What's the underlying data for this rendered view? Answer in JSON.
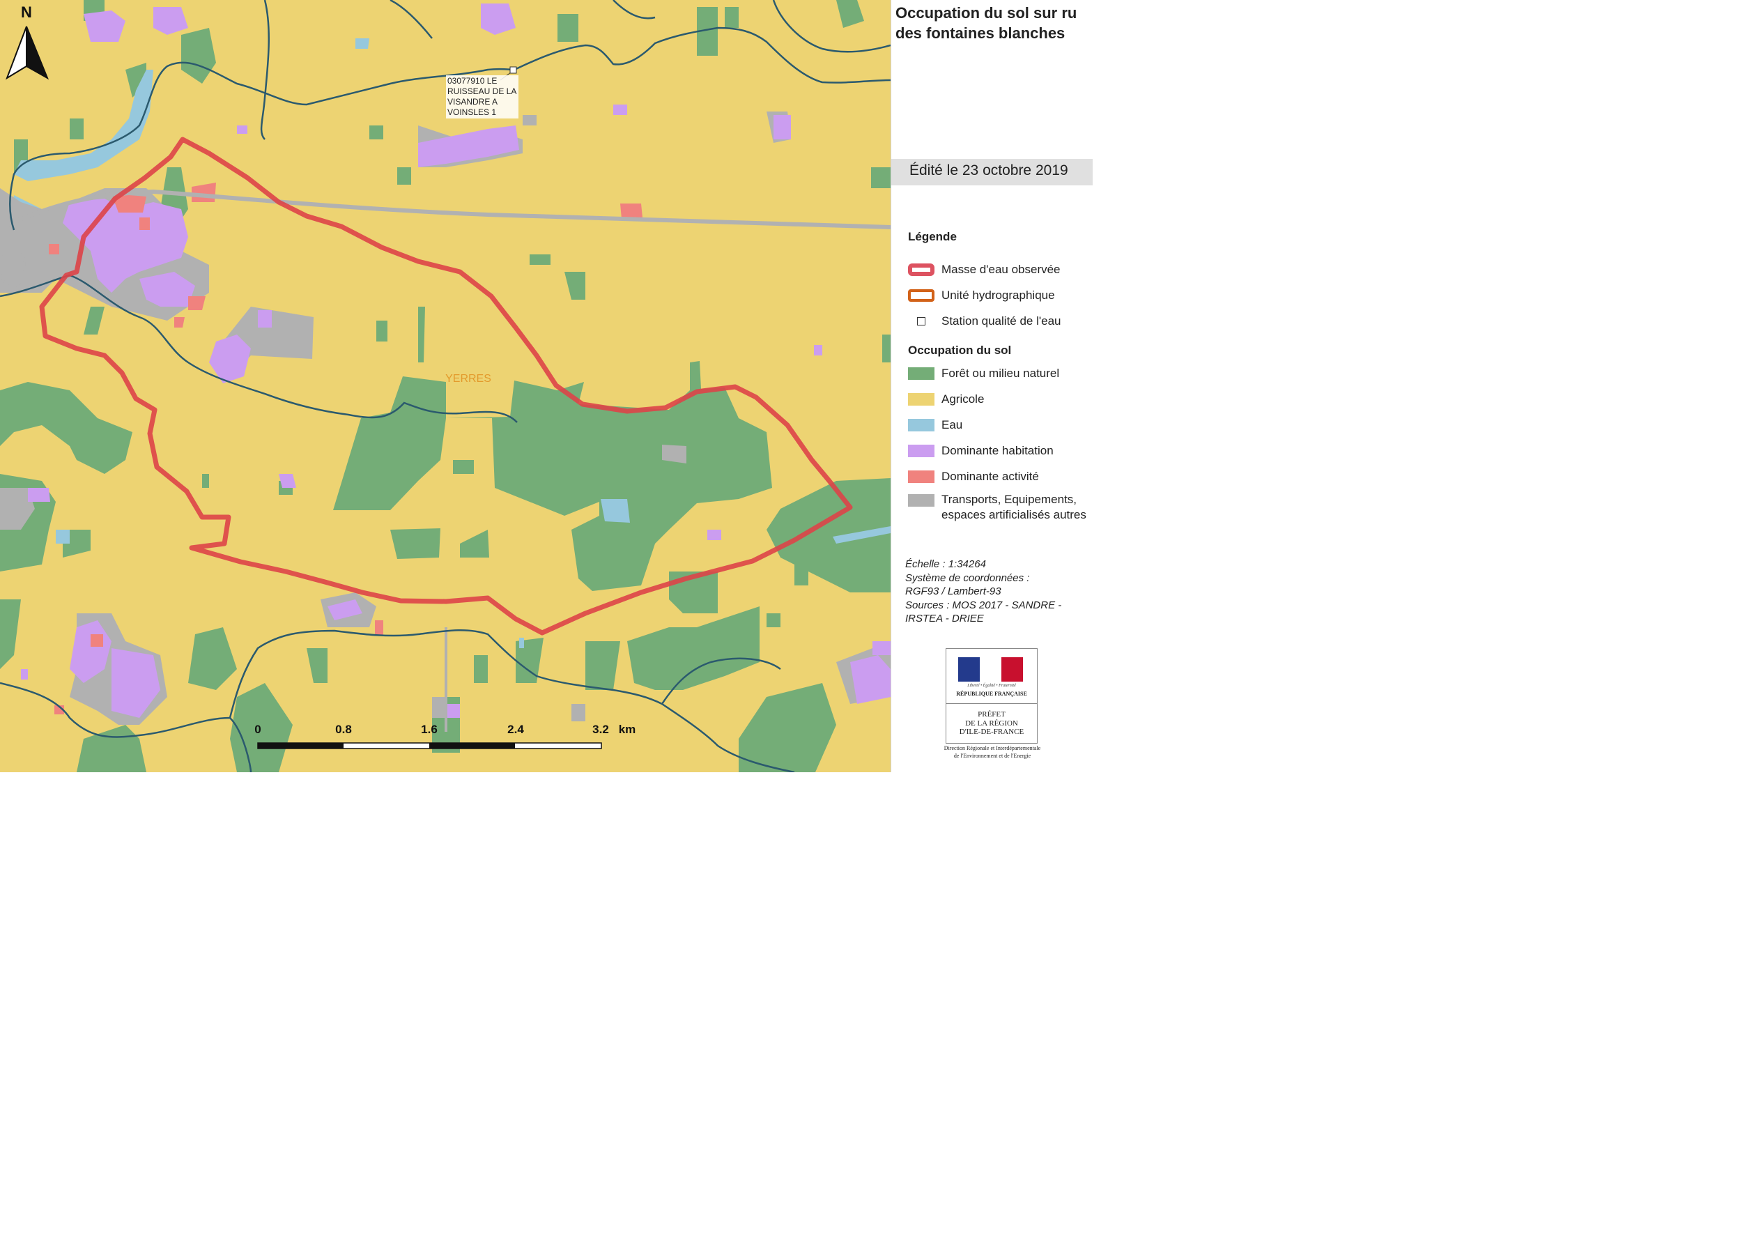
{
  "map": {
    "north_label": "N",
    "station_label_lines": [
      "03077910   LE",
      "RUISSEAU DE LA",
      "VISANDRE A",
      "VOINSLES 1"
    ],
    "place_label": "YERRES",
    "scale_ticks": [
      "0",
      "0.8",
      "1.6",
      "2.4",
      "3.2"
    ],
    "scale_unit": "km"
  },
  "panel": {
    "title": "Occupation du sol sur ru des fontaines blanches",
    "date": "Édité le 23 octobre 2019",
    "legend_heading": "Légende",
    "legend_items": [
      {
        "label": "Masse d'eau observée",
        "symbol": "red-outline"
      },
      {
        "label": "Unité hydrographique",
        "symbol": "orange-outline"
      },
      {
        "label": "Station qualité de l'eau",
        "symbol": "station-square"
      }
    ],
    "land_use_heading": "Occupation du sol",
    "land_use_items": [
      {
        "label": "Forêt ou milieu naturel",
        "color": "#74ad77"
      },
      {
        "label": "Agricole",
        "color": "#edd372"
      },
      {
        "label": "Eau",
        "color": "#96c8dd"
      },
      {
        "label": "Dominante habitation",
        "color": "#cb9df0"
      },
      {
        "label": "Dominante activité",
        "color": "#f0827e"
      },
      {
        "label": "Transports, Equipements, espaces artificialisés autres",
        "color": "#b1b1b1"
      }
    ],
    "metadata_lines": [
      "Échelle :  1:34264",
      "Système de coordonnées :",
      "RGF93 / Lambert-93",
      "Sources : MOS 2017 - SANDRE -",
      "IRSTEA - DRIEE"
    ],
    "logo": {
      "motto": "Liberté • Égalité • Fraternité",
      "republic": "RÉPUBLIQUE FRANÇAISE",
      "prefet_lines": [
        "PRÉFET",
        "DE LA RÉGION",
        "D'ILE-DE-FRANCE"
      ],
      "direction_lines": [
        "Direction Régionale et Interdépartementale",
        "de l'Environnement et de l'Energie"
      ]
    }
  },
  "colors": {
    "forest": "#74ad77",
    "agri": "#edd372",
    "water": "#96c8dd",
    "habitat": "#cb9df0",
    "activity": "#f0827e",
    "transport": "#b1b1b1",
    "river": "#2b5a6e",
    "boundary": "#dd4448"
  }
}
